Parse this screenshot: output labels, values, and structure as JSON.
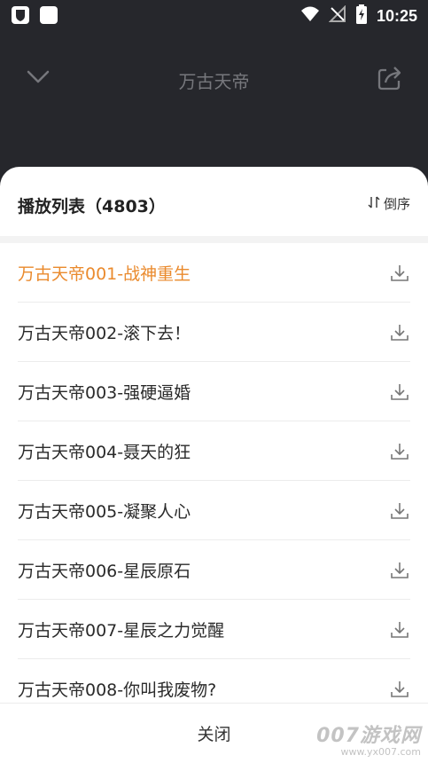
{
  "status_bar": {
    "time": "10:25",
    "icons": [
      "shield-notification-icon",
      "square-notification-icon",
      "wifi-icon",
      "no-signal-icon",
      "battery-charging-icon"
    ]
  },
  "header": {
    "title": "万古天帝",
    "back_icon": "chevron-down-icon",
    "share_icon": "share-icon"
  },
  "playlist": {
    "title": "播放列表（4803）",
    "sort_label": "倒序",
    "sort_icon": "sort-arrows-icon",
    "active_index": 0,
    "active_color": "#ea8a2d",
    "items": [
      {
        "title": "万古天帝001-战神重生"
      },
      {
        "title": "万古天帝002-滚下去！"
      },
      {
        "title": "万古天帝003-强硬逼婚"
      },
      {
        "title": "万古天帝004-聂天的狂"
      },
      {
        "title": "万古天帝005-凝聚人心"
      },
      {
        "title": "万古天帝006-星辰原石"
      },
      {
        "title": "万古天帝007-星辰之力觉醒"
      },
      {
        "title": "万古天帝008-你叫我废物?"
      }
    ],
    "download_icon": "download-icon"
  },
  "footer": {
    "close_label": "关闭"
  },
  "watermark": {
    "main": "007游戏网",
    "sub": "www.yx007.com"
  }
}
